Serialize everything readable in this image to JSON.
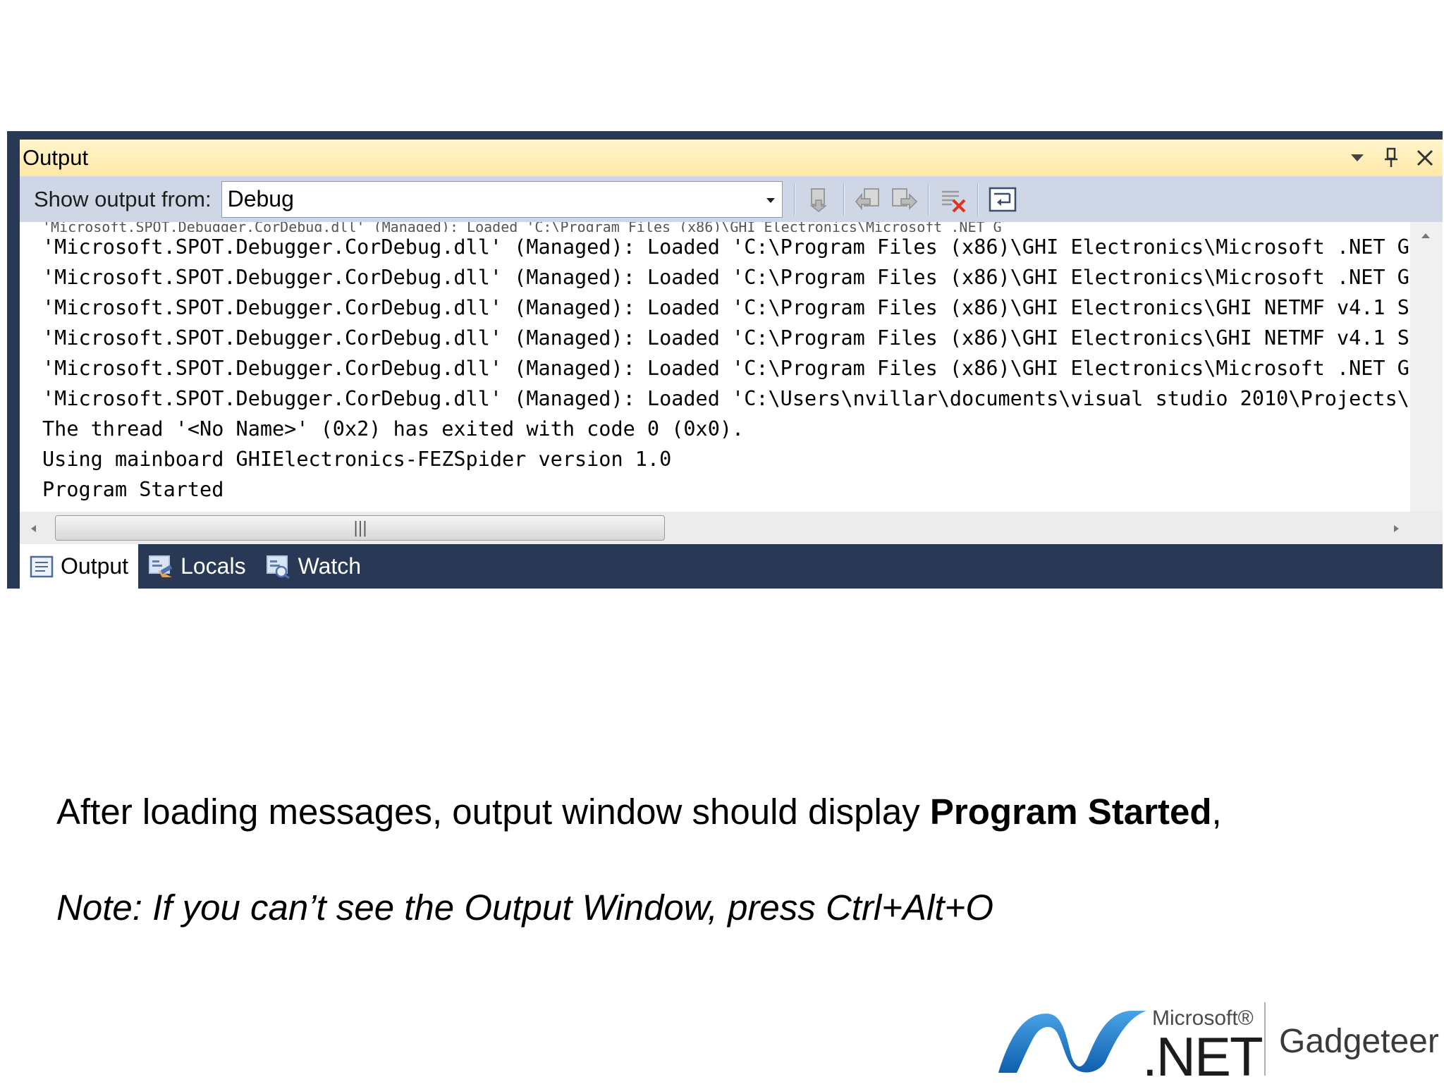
{
  "window": {
    "title": "Output",
    "show_output_label": "Show output from:",
    "output_source": "Debug"
  },
  "output": {
    "lines": [
      "'Microsoft.SPOT.Debugger.CorDebug.dll' (Managed): Loaded 'C:\\Program Files (x86)\\GHI Electronics\\Microsoft .NET G",
      "'Microsoft.SPOT.Debugger.CorDebug.dll' (Managed): Loaded 'C:\\Program Files (x86)\\GHI Electronics\\Microsoft .NET G",
      "'Microsoft.SPOT.Debugger.CorDebug.dll' (Managed): Loaded 'C:\\Program Files (x86)\\GHI Electronics\\GHI NETMF v4.1 S",
      "'Microsoft.SPOT.Debugger.CorDebug.dll' (Managed): Loaded 'C:\\Program Files (x86)\\GHI Electronics\\GHI NETMF v4.1 S",
      "'Microsoft.SPOT.Debugger.CorDebug.dll' (Managed): Loaded 'C:\\Program Files (x86)\\GHI Electronics\\Microsoft .NET G",
      "'Microsoft.SPOT.Debugger.CorDebug.dll' (Managed): Loaded 'C:\\Users\\nvillar\\documents\\visual studio 2010\\Projects\\",
      "The thread '<No Name>' (0x2) has exited with code 0 (0x0).",
      "Using mainboard GHIElectronics-FEZSpider version 1.0",
      "Program Started"
    ]
  },
  "tabs": [
    {
      "label": "Output",
      "icon": "output-icon"
    },
    {
      "label": "Locals",
      "icon": "locals-icon"
    },
    {
      "label": "Watch",
      "icon": "watch-icon"
    }
  ],
  "slide": {
    "caption_before": "After loading messages, output window should display ",
    "caption_bold": "Program Started",
    "caption_after": ",",
    "note": "Note: If you can’t see the Output Window, press Ctrl+Alt+O"
  },
  "logo": {
    "microsoft": "Microsoft®",
    "net": ".NET",
    "gadgeteer": "Gadgeteer"
  },
  "colors": {
    "frame": "#293955",
    "titlebar": "#ffe8a6",
    "toolbar": "#cfd6e5",
    "logo_blue": "#1570c4"
  }
}
